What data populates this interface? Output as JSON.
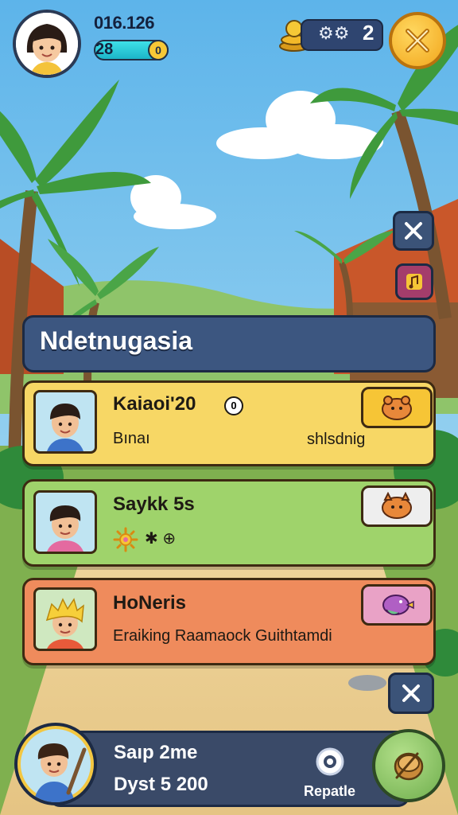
{
  "hud": {
    "score": "016.126",
    "level": "28",
    "coin_symbol": "0",
    "resource_count": "2"
  },
  "panel": {
    "title": "Ndetnugasia"
  },
  "cards": [
    {
      "name": "Kaiaoi'20",
      "badge": "0",
      "subtitle": "Bınaı",
      "right_text": "shlsdnig",
      "pet": "orange-creature-icon"
    },
    {
      "name": "Saykk 5s",
      "subtitle": "✱ ⊕",
      "pet": "orange-beast-icon"
    },
    {
      "name": "HoNeris",
      "subtitle": "Eraiking Raamaock Guithtamdi",
      "pet": "purple-bird-icon"
    }
  ],
  "bottom": {
    "line1": "Saıp 2me",
    "line2": "Dyst 5 200",
    "repeat_label": "Repatle"
  },
  "colors": {
    "sky": "#5fb7e9",
    "panel": "#3c5680",
    "card1": "#f7d765",
    "card2": "#9fd36b",
    "card3": "#ef8b5c",
    "gold": "#f2a61c"
  }
}
